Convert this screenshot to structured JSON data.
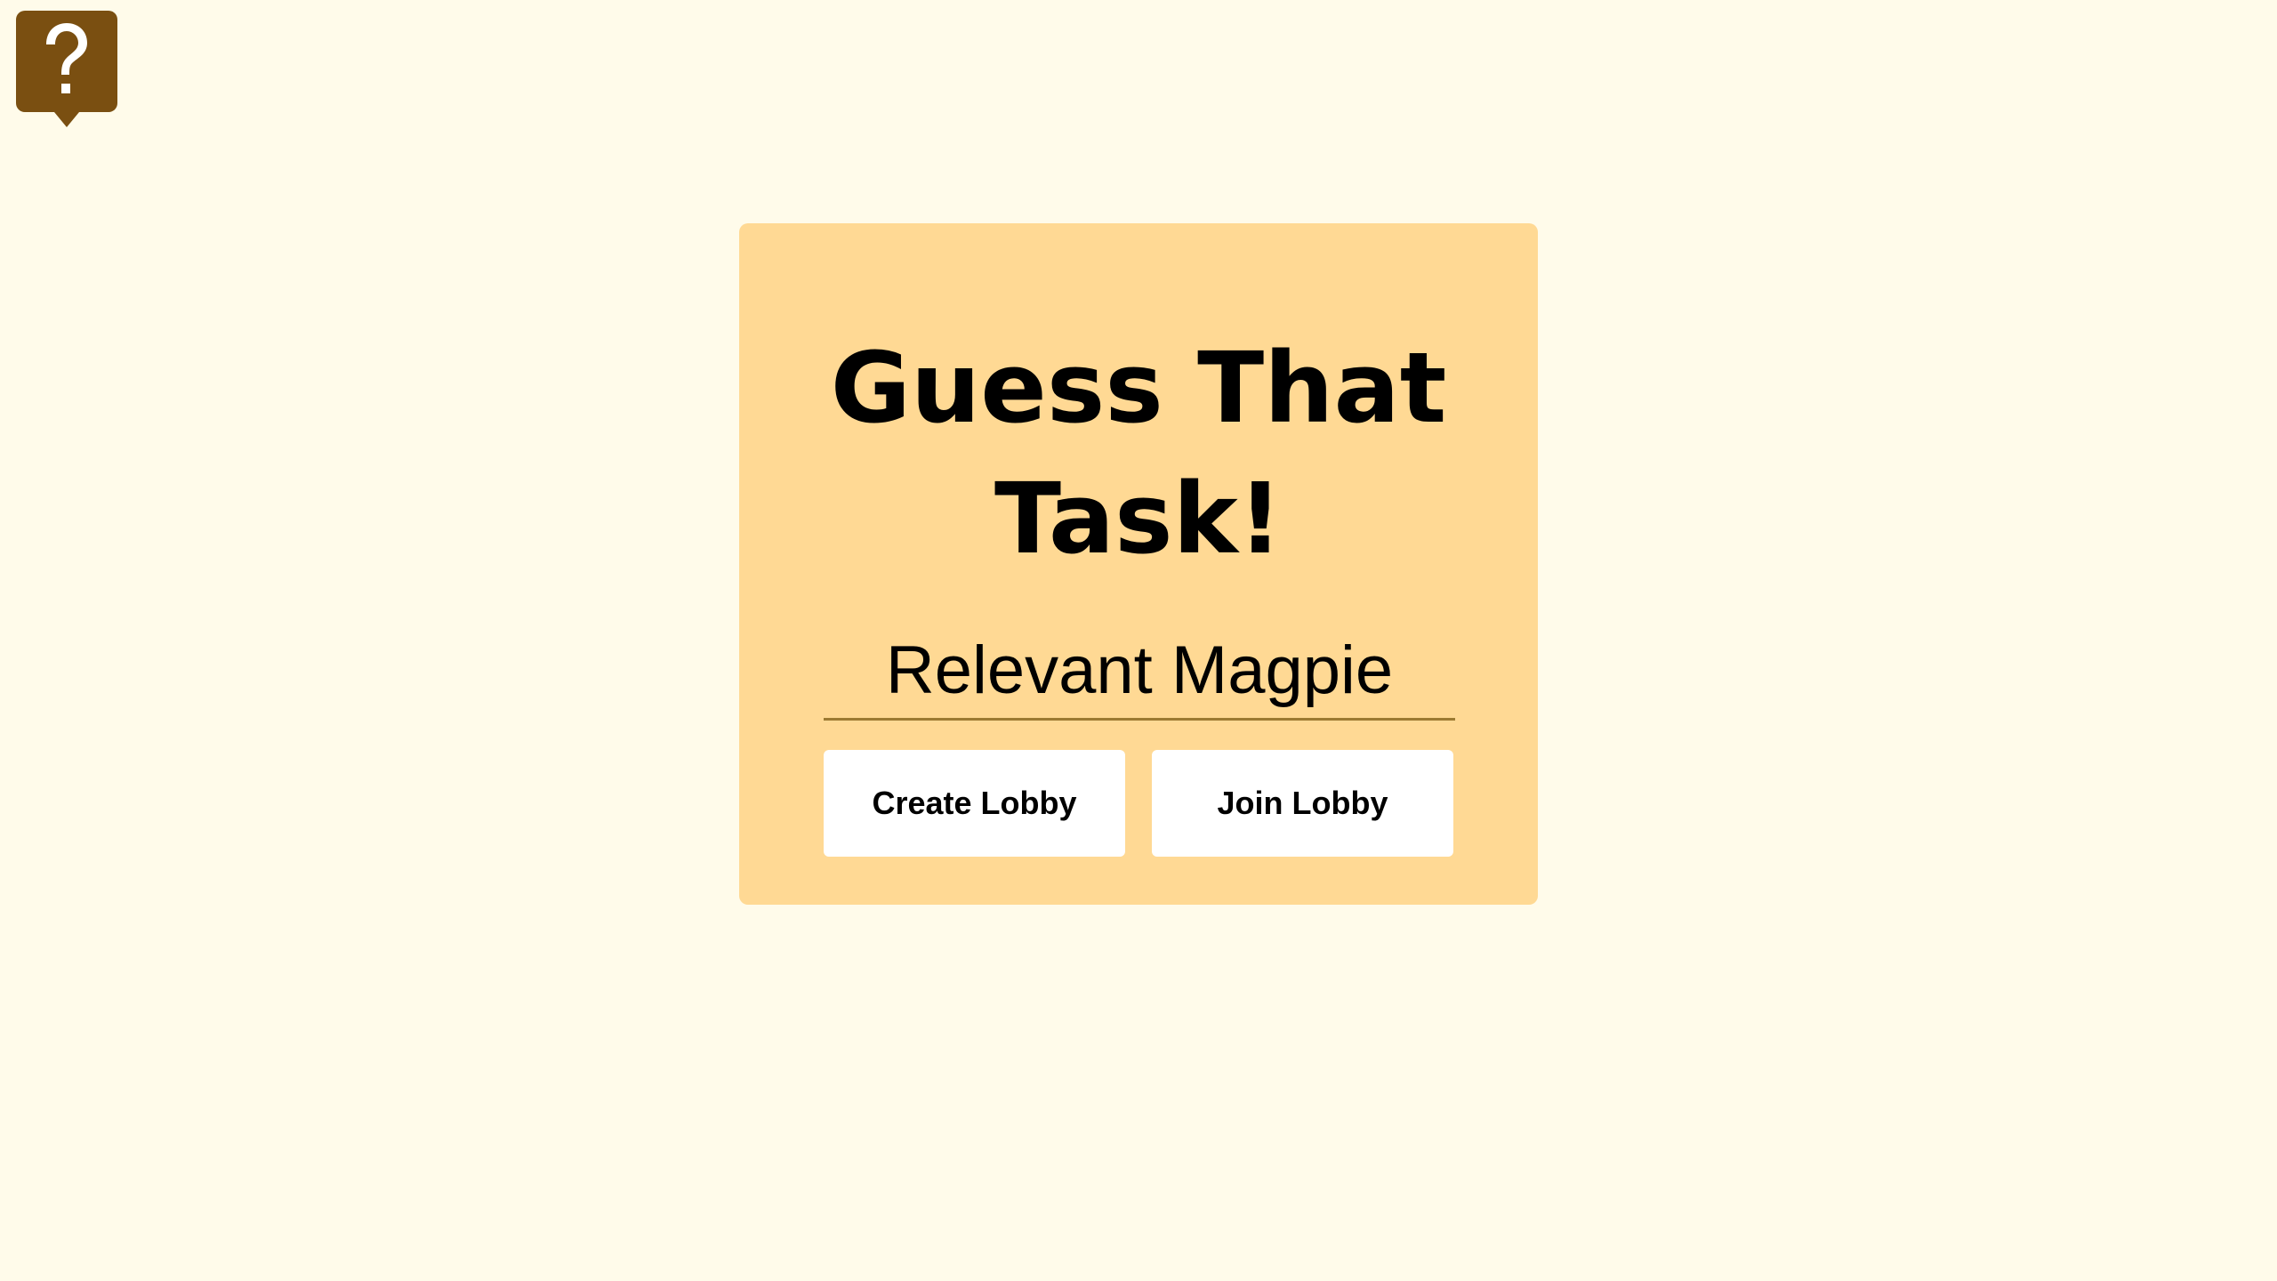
{
  "help": {
    "icon": "question-mark-icon",
    "color": "#7a4f11"
  },
  "card": {
    "title_line1": "Guess That",
    "title_line2": "Task!",
    "background": "#ffd994"
  },
  "name_input": {
    "value": "Relevant Magpie"
  },
  "actions": {
    "create_label": "Create Lobby",
    "join_label": "Join Lobby"
  },
  "page": {
    "background": "#fffbea"
  }
}
